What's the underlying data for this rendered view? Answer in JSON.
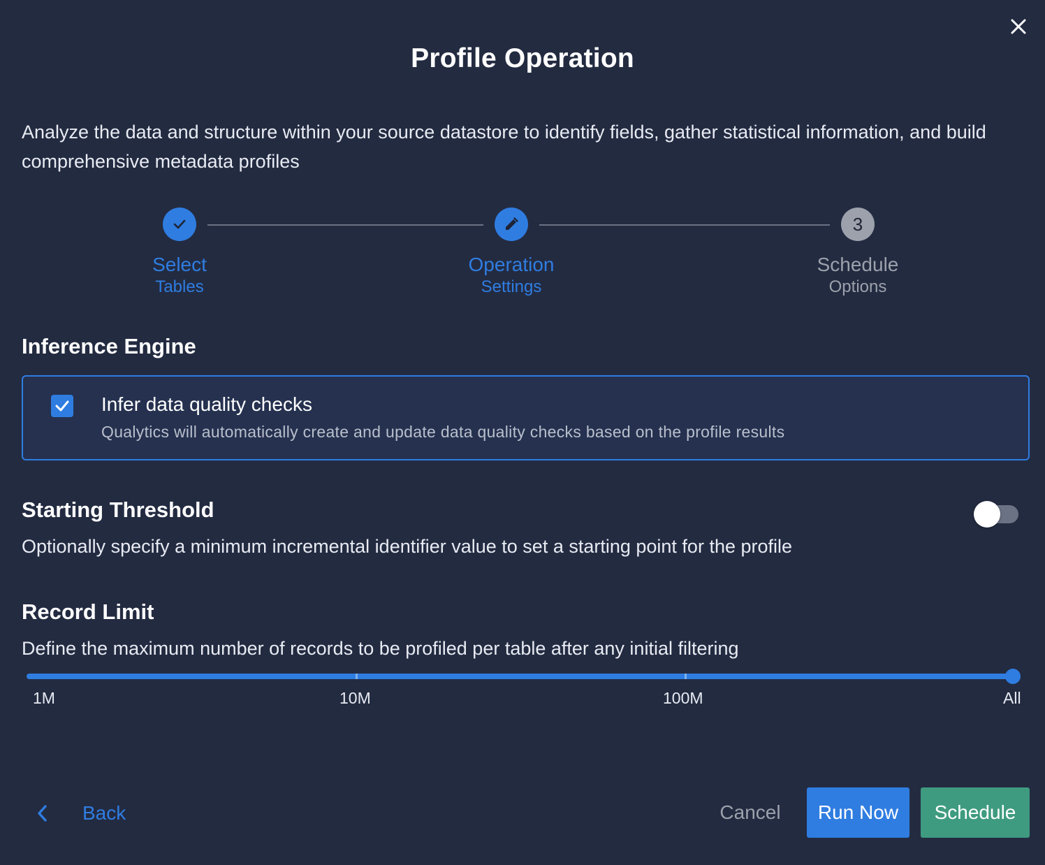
{
  "dialog": {
    "title": "Profile Operation",
    "description": "Analyze the data and structure within your source datastore to identify fields, gather statistical information, and build comprehensive metadata profiles",
    "close_icon": "close-icon"
  },
  "stepper": {
    "steps": [
      {
        "line1": "Select",
        "line2": "Tables",
        "state": "completed",
        "icon": "check-icon"
      },
      {
        "line1": "Operation",
        "line2": "Settings",
        "state": "active",
        "icon": "pencil-icon"
      },
      {
        "line1": "Schedule",
        "line2": "Options",
        "state": "pending",
        "number": "3"
      }
    ]
  },
  "inference_engine": {
    "title": "Inference Engine",
    "checkbox_checked": true,
    "option_title": "Infer data quality checks",
    "option_description": "Qualytics will automatically create and update data quality checks based on the profile results"
  },
  "starting_threshold": {
    "title": "Starting Threshold",
    "description": "Optionally specify a minimum incremental identifier value to set a starting point for the profile",
    "enabled": false
  },
  "record_limit": {
    "title": "Record Limit",
    "description": "Define the maximum number of records to be profiled per table after any initial filtering",
    "marks": [
      "1M",
      "10M",
      "100M",
      "All"
    ],
    "selected": "All"
  },
  "footer": {
    "back_label": "Back",
    "cancel_label": "Cancel",
    "run_now_label": "Run Now",
    "schedule_label": "Schedule"
  },
  "colors": {
    "background": "#232b41",
    "accent": "#2f7de1",
    "schedule_button": "#3f9b80",
    "muted": "#9ca1ab"
  }
}
